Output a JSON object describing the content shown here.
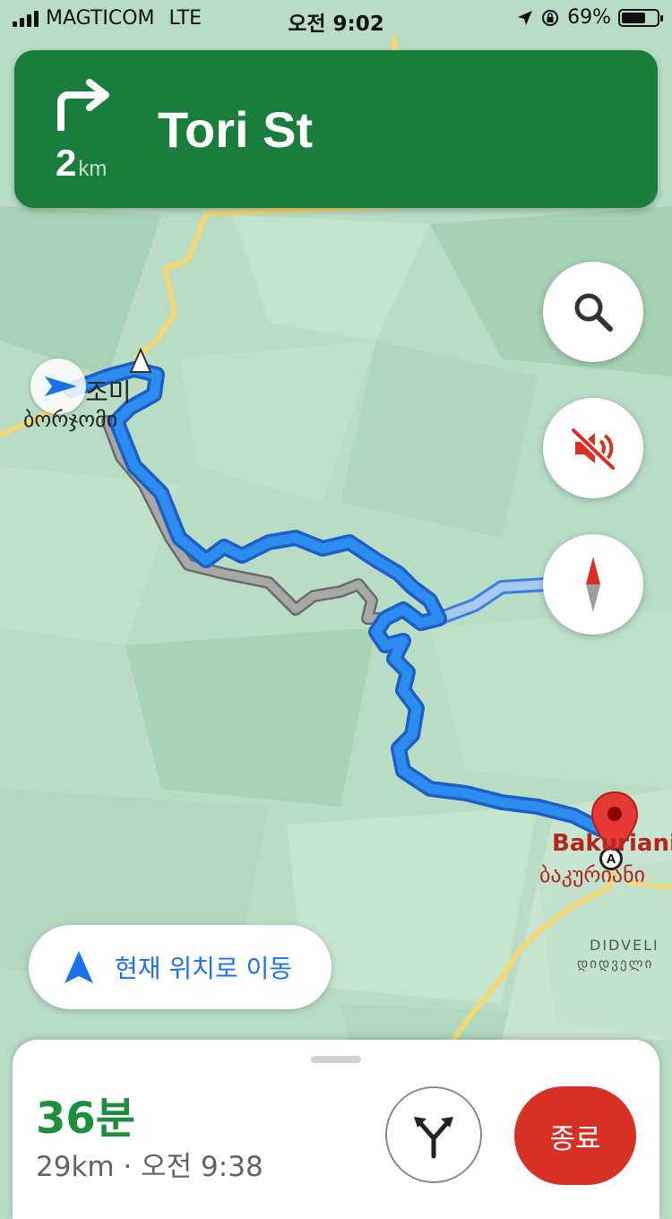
{
  "status_bar": {
    "carrier": "MAGTICOM",
    "network": "LTE",
    "time": "오전 9:02",
    "battery": "69%"
  },
  "navigation": {
    "distance_value": "2",
    "distance_unit": "km",
    "street": "Tori St",
    "turn_icon": "turn-right-icon"
  },
  "map": {
    "origin_label_ko": "조미",
    "origin_label_ka": "ბორჯომი",
    "destination_label_en": "Bakuriani",
    "destination_label_ka": "ბაკურიანი",
    "poi_label_en": "DIDVELI",
    "poi_label_ka": "დიდველი",
    "marker_letter": "A"
  },
  "controls": {
    "search_icon": "search-icon",
    "mute_icon": "sound-off-icon",
    "compass_icon": "compass-icon",
    "recenter_label": "현재 위치로 이동"
  },
  "bottom_sheet": {
    "eta_minutes": "36분",
    "eta_detail": "29km · 오전 9:38",
    "alt_routes_icon": "alternate-routes-icon",
    "exit_label": "종료"
  },
  "colors": {
    "banner_green": "#197e3b",
    "route_blue": "#2d8cf0",
    "eta_green": "#1e8e3e",
    "exit_red": "#d93025",
    "accent_blue": "#1a73e8"
  }
}
